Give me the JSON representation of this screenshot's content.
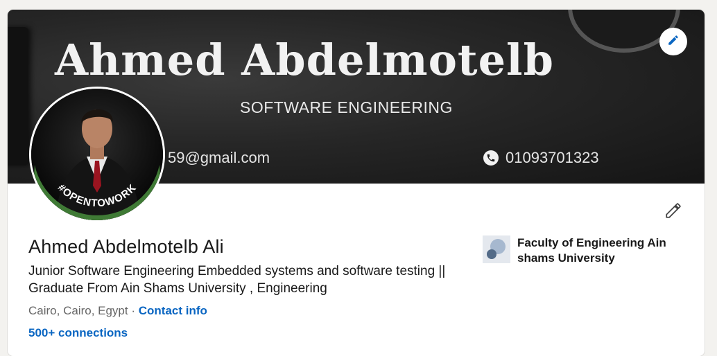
{
  "banner": {
    "title": "Ahmed Abdelmotelb",
    "subtitle": "SOFTWARE ENGINEERING",
    "email_fragment": "59@gmail.com",
    "phone": "01093701323"
  },
  "avatar": {
    "badge_text": "#OPENTOWORK",
    "badge_color": "#3f7a35"
  },
  "profile": {
    "name": "Ahmed Abdelmotelb Ali",
    "headline": "Junior Software Engineering Embedded systems and software testing || Graduate From Ain Shams University , Engineering",
    "location": "Cairo, Cairo, Egypt",
    "separator": " · ",
    "contact_label": "Contact info",
    "connections_label": "500+ connections"
  },
  "education": {
    "name": "Faculty of Engineering Ain shams University"
  },
  "icons": {
    "banner_edit": "pencil-icon",
    "section_edit": "pencil-icon",
    "phone": "phone-icon"
  },
  "colors": {
    "link": "#0a66c2",
    "text": "#191919",
    "muted": "#666666",
    "page_bg": "#f3f2ef"
  }
}
